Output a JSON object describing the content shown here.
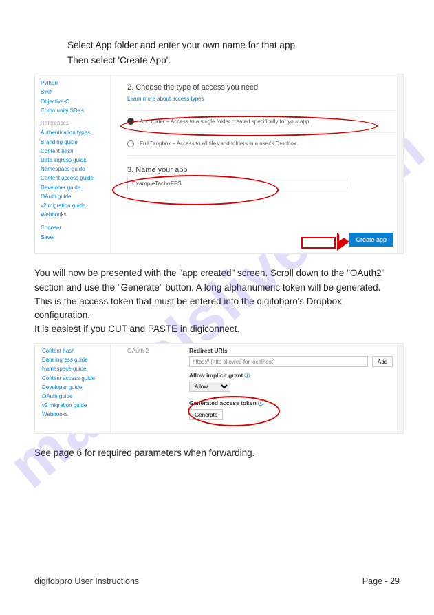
{
  "intro": {
    "line1": "Select App folder and enter your own name for that app.",
    "line2": "Then select 'Create App'."
  },
  "shot1": {
    "sidebar": {
      "items_top": [
        "Python",
        "Swift",
        "Objective-C",
        "Community SDKs"
      ],
      "head_ref": "References",
      "items_ref": [
        "Authentication types",
        "Branding guide",
        "Content hash",
        "Data ingress guide",
        "Namespace guide",
        "Content access guide",
        "Developer guide",
        "OAuth guide",
        "v2 migration guide",
        "Webhooks"
      ],
      "items_bot": [
        "Chooser",
        "Saver"
      ]
    },
    "step2_title": "2. Choose the type of access you need",
    "learn": "Learn more about access types",
    "option1": "App folder – Access to a single folder created specifically for your app.",
    "option2": "Full Dropbox – Access to all files and folders in a user's Dropbox.",
    "step3_title": "3. Name your app",
    "name_value": "ExampleTachoFFS",
    "create_label": "Create app"
  },
  "para": {
    "l1": "You will now be presented with the \"app created\" screen. Scroll down to the \"OAuth2\"",
    "l2": "section and use the \"Generate\" button. A long alphanumeric token will be generated.",
    "l3": "This is the access token that must be entered into the digifobpro's Dropbox configuration.",
    "l4": "It is easiest if you CUT and PASTE in digiconnect."
  },
  "shot2": {
    "sidebar_items": [
      "Content hash",
      "Data ingress guide",
      "Namespace guide",
      "Content access guide",
      "Developer guide",
      "OAuth guide",
      "v2 migration guide",
      "Webhooks"
    ],
    "section_head": "OAuth 2",
    "redirect_label": "Redirect URIs",
    "redirect_placeholder": "https:// (http allowed for localhost)",
    "add_label": "Add",
    "implicit_label": "Allow implicit grant",
    "implicit_value": "Allow",
    "token_label": "Generated access token",
    "generate_label": "Generate"
  },
  "closing": "See page 6 for required parameters when forwarding.",
  "footer": {
    "left": "digifobpro User Instructions",
    "right": "Page - 29"
  },
  "watermark": "manualslive.com"
}
